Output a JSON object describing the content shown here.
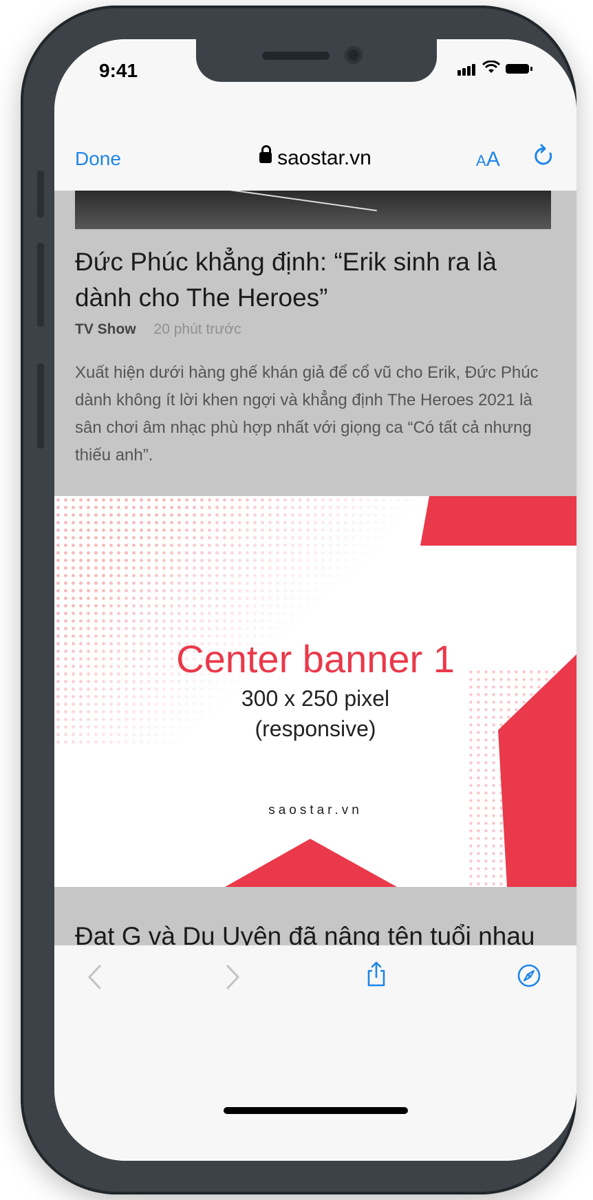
{
  "status_bar": {
    "time": "9:41"
  },
  "safari": {
    "done_label": "Done",
    "domain": "saostar.vn",
    "text_size_small": "A",
    "text_size_large": "A"
  },
  "article": {
    "title": "Đức Phúc khẳng định: “Erik sinh ra là dành cho The Heroes”",
    "category": "TV Show",
    "time_ago": "20 phút trước",
    "summary": "Xuất hiện dưới hàng ghế khán giả để cổ vũ cho Erik, Đức Phúc dành không ít lời khen ngợi và khẳng định The Heroes 2021 là sân chơi âm nhạc phù hợp nhất với giọng ca “Có tất cả nhưng thiếu anh”."
  },
  "banner": {
    "title": "Center banner 1",
    "size": "300 x 250 pixel",
    "note": "(responsive)",
    "brand": "saostar.vn",
    "accent_color": "#e9394a"
  },
  "next_article": {
    "title": "Đạt G và Du Uyên đã nâng tên tuổi nhau thế nào?"
  },
  "toolbar": {
    "icons": [
      "back-icon",
      "forward-icon",
      "share-icon",
      "compass-icon"
    ]
  }
}
